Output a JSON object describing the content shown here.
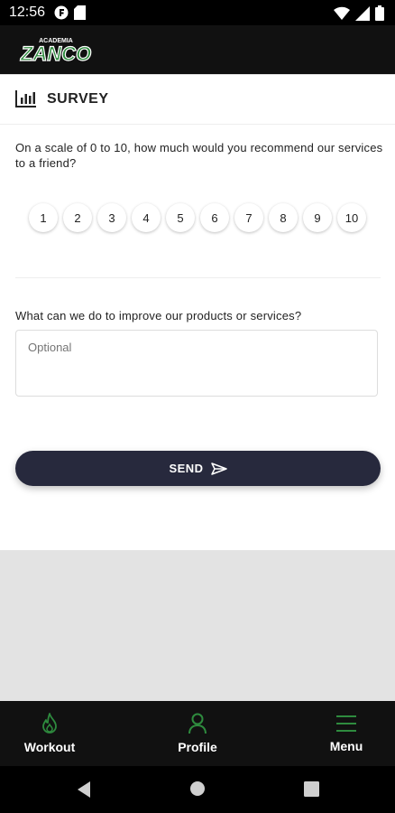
{
  "status": {
    "time": "12:56"
  },
  "app": {
    "logo_small": "ACADEMIA",
    "logo_big": "ZANCO"
  },
  "survey": {
    "title": "SURVEY",
    "question1": "On a scale of 0 to 10, how much would you recommend our services to a friend?",
    "scale": [
      "1",
      "2",
      "3",
      "4",
      "5",
      "6",
      "7",
      "8",
      "9",
      "10"
    ],
    "question2": "What can we do to improve our products or services?",
    "placeholder": "Optional",
    "send_label": "SEND"
  },
  "nav": {
    "workout": "Workout",
    "profile": "Profile",
    "menu": "Menu"
  },
  "colors": {
    "accent": "#2e8b3e",
    "button": "#27293d"
  }
}
